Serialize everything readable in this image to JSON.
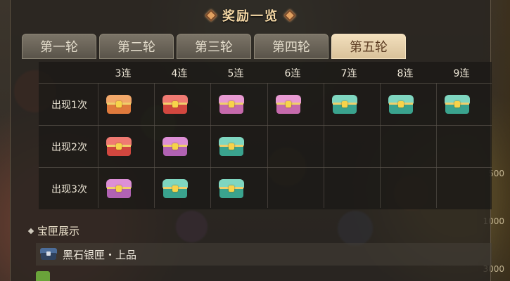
{
  "title": "奖励一览",
  "tabs": [
    {
      "label": "第一轮",
      "active": false
    },
    {
      "label": "第二轮",
      "active": false
    },
    {
      "label": "第三轮",
      "active": false
    },
    {
      "label": "第四轮",
      "active": false
    },
    {
      "label": "第五轮",
      "active": true
    }
  ],
  "table": {
    "columns": [
      "3连",
      "4连",
      "5连",
      "6连",
      "7连",
      "8连",
      "9连"
    ],
    "rows": [
      {
        "label": "出现1次",
        "chests": [
          "orange-chest-icon",
          "red-chest-icon",
          "pink-chest-icon",
          "pink-chest-icon",
          "teal-chest-icon",
          "teal-chest-icon",
          "teal-chest-icon"
        ]
      },
      {
        "label": "出现2次",
        "chests": [
          "red-chest-icon",
          "purple-chest-icon",
          "teal-chest-icon"
        ]
      },
      {
        "label": "出现3次",
        "chests": [
          "purple-chest-icon",
          "teal-chest-icon",
          "teal-chest-icon"
        ]
      }
    ]
  },
  "chest_colors": {
    "orange-chest-icon": {
      "lid": "#f2a86a",
      "body": "#e07a3c"
    },
    "red-chest-icon": {
      "lid": "#f07a72",
      "body": "#d2473f"
    },
    "pink-chest-icon": {
      "lid": "#e89ad2",
      "body": "#c66aac"
    },
    "purple-chest-icon": {
      "lid": "#dd8fd6",
      "body": "#b162b3"
    },
    "teal-chest-icon": {
      "lid": "#7fd6c0",
      "body": "#3aa38e"
    }
  },
  "showcase": {
    "heading": "宝匣展示",
    "items": [
      {
        "name": "黑石银匣・上品",
        "icon": "silver-chest-icon"
      }
    ]
  },
  "background_scores": [
    "500",
    "1000",
    "3000"
  ]
}
